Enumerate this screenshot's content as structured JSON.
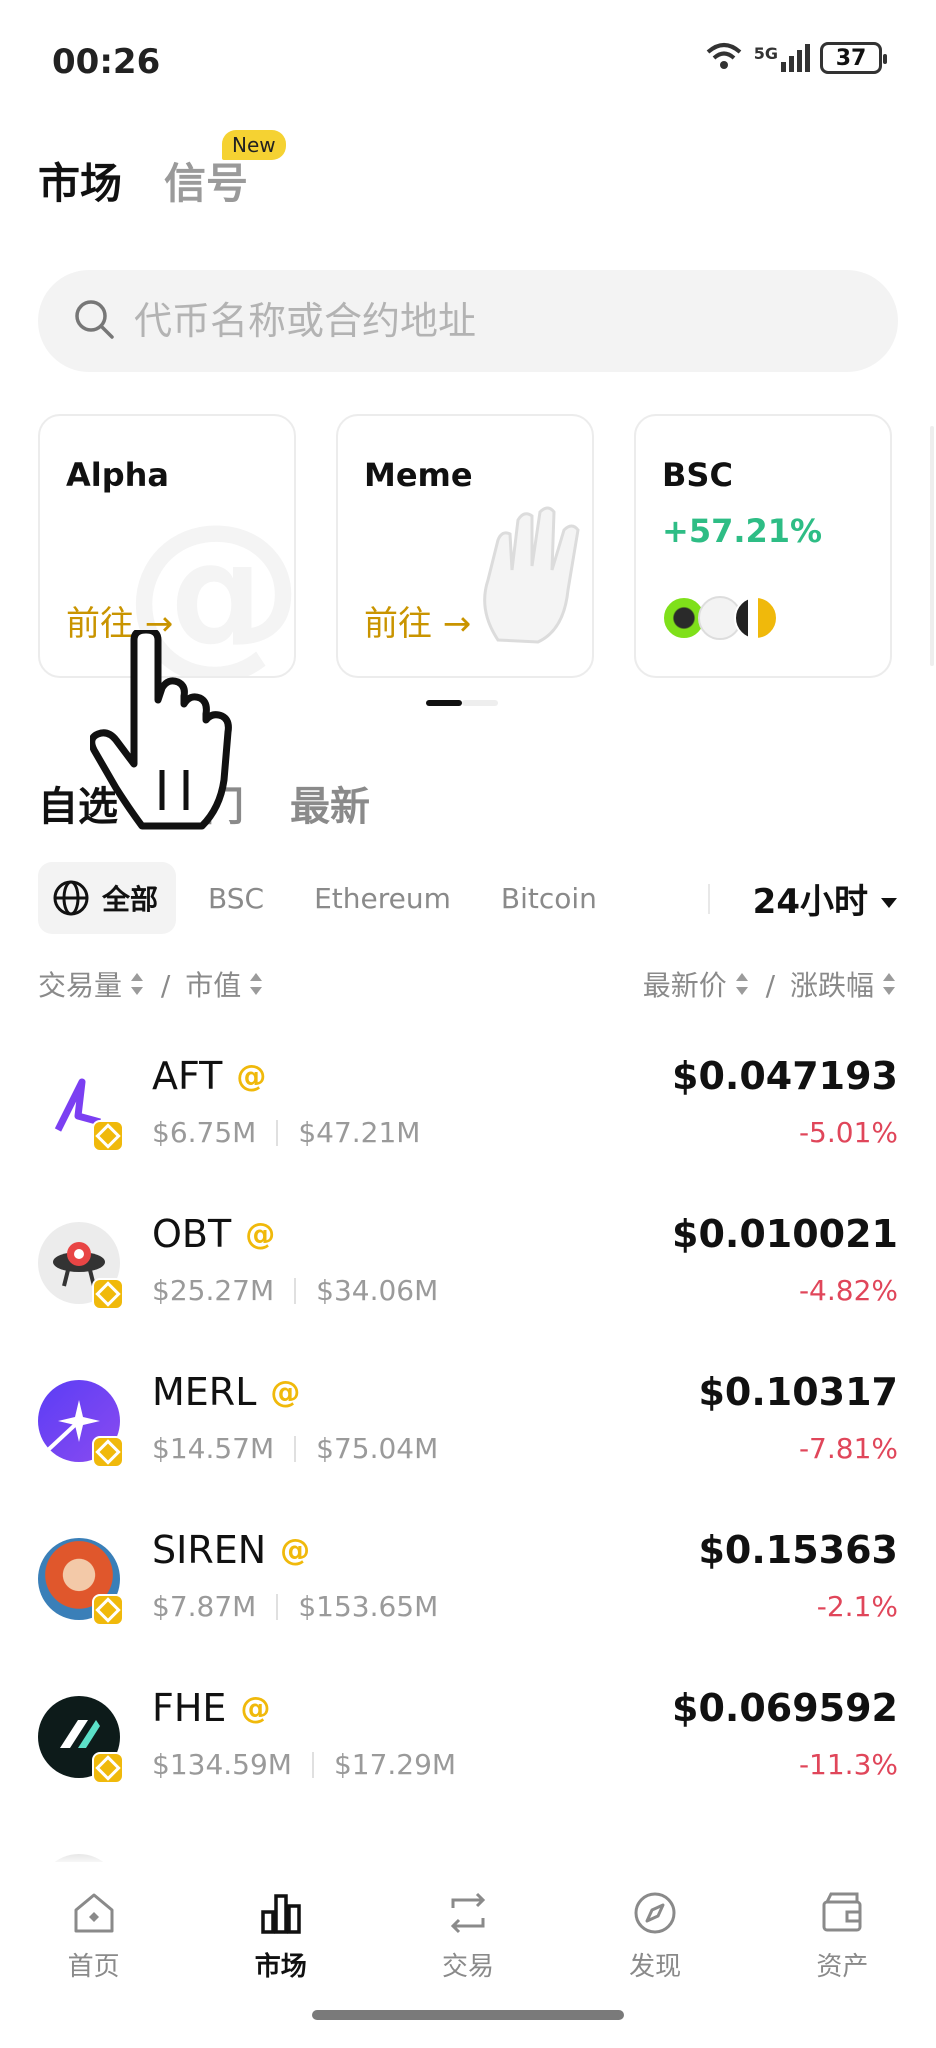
{
  "status": {
    "time": "00:26",
    "network": "5G",
    "battery": "37"
  },
  "top_tabs": [
    {
      "label": "市场",
      "active": true
    },
    {
      "label": "信号",
      "badge": "New"
    }
  ],
  "search": {
    "placeholder": "代币名称或合约地址"
  },
  "cards": [
    {
      "title": "Alpha",
      "action": "前往 →"
    },
    {
      "title": "Meme",
      "action": "前往 →"
    },
    {
      "title": "BSC",
      "change": "+57.21%"
    }
  ],
  "section_tabs": [
    "自选",
    "热门",
    "最新"
  ],
  "filters": {
    "chips": [
      "全部",
      "BSC",
      "Ethereum",
      "Bitcoin"
    ],
    "period": "24小时"
  },
  "sort_header": {
    "left": "交易量",
    "left2": "市值",
    "right": "最新价",
    "right2": "涨跌幅"
  },
  "tokens": [
    {
      "symbol": "AFT",
      "volume": "$6.75M",
      "mcap": "$47.21M",
      "price": "$0.047193",
      "change": "-5.01%"
    },
    {
      "symbol": "OBT",
      "volume": "$25.27M",
      "mcap": "$34.06M",
      "price": "$0.010021",
      "change": "-4.82%"
    },
    {
      "symbol": "MERL",
      "volume": "$14.57M",
      "mcap": "$75.04M",
      "price": "$0.10317",
      "change": "-7.81%"
    },
    {
      "symbol": "SIREN",
      "volume": "$7.87M",
      "mcap": "$153.65M",
      "price": "$0.15363",
      "change": "-2.1%"
    },
    {
      "symbol": "FHE",
      "volume": "$134.59M",
      "mcap": "$17.29M",
      "price": "$0.069592",
      "change": "-11.3%"
    }
  ],
  "alpha_symbol": "@",
  "nav": [
    {
      "label": "首页",
      "icon": "home-icon"
    },
    {
      "label": "市场",
      "icon": "chart-icon",
      "active": true
    },
    {
      "label": "交易",
      "icon": "swap-icon"
    },
    {
      "label": "发现",
      "icon": "compass-icon"
    },
    {
      "label": "资产",
      "icon": "wallet-icon"
    }
  ],
  "colors": {
    "brand": "#F0B90B",
    "up": "#2EBD85",
    "down": "#E0465A",
    "link": "#C99400"
  }
}
